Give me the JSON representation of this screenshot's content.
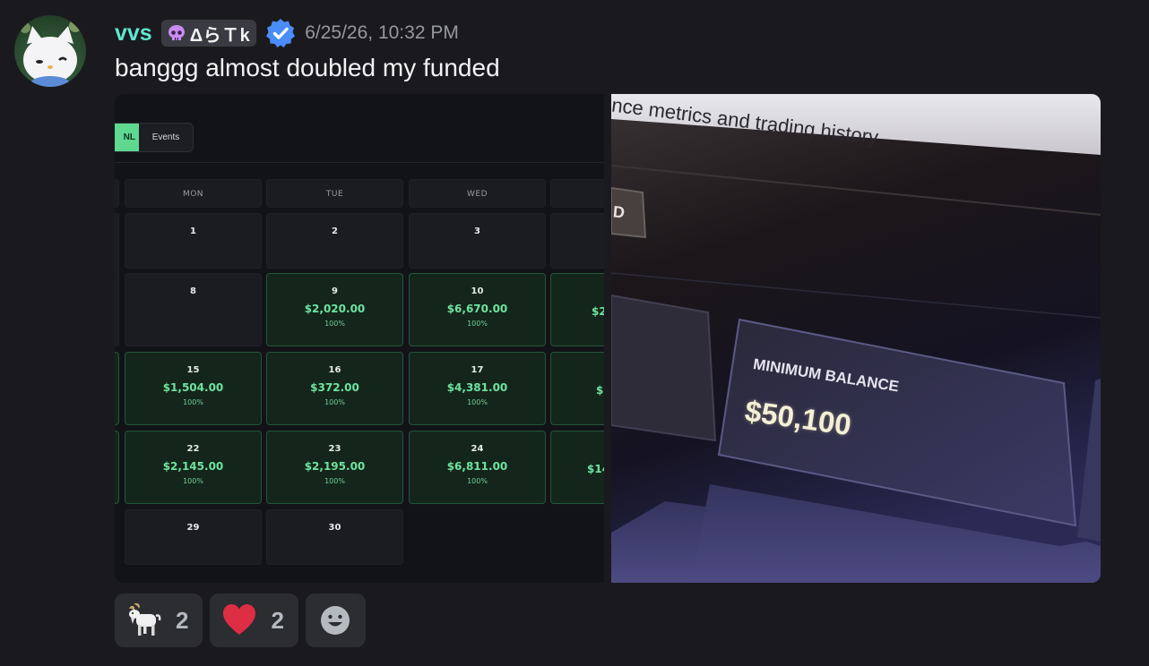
{
  "message": {
    "username": "vvs",
    "server_tag": "ΔらＴk",
    "timestamp": "6/25/26, 10:32 PM",
    "content": "banggg almost doubled my funded",
    "accent_color": "#5ee6d0"
  },
  "calendar": {
    "toggle": {
      "pnl_label": "NL",
      "events_label": "Events"
    },
    "day_headers": [
      "MON",
      "TUE",
      "WED"
    ],
    "weeks": [
      {
        "days": [
          {
            "day": "1",
            "pnl": "",
            "pct": ""
          },
          {
            "day": "2",
            "pnl": "",
            "pct": ""
          },
          {
            "day": "3",
            "pnl": "",
            "pct": ""
          },
          {
            "day": "",
            "pnl": "",
            "pct": ""
          }
        ]
      },
      {
        "days": [
          {
            "day": "8",
            "pnl": "",
            "pct": ""
          },
          {
            "day": "9",
            "pnl": "$2,020.00",
            "pct": "100%"
          },
          {
            "day": "10",
            "pnl": "$6,670.00",
            "pct": "100%"
          },
          {
            "day": "",
            "pnl": "$2",
            "pct": ""
          }
        ]
      },
      {
        "days": [
          {
            "day": "15",
            "pnl": "$1,504.00",
            "pct": "100%"
          },
          {
            "day": "16",
            "pnl": "$372.00",
            "pct": "100%"
          },
          {
            "day": "17",
            "pnl": "$4,381.00",
            "pct": "100%"
          },
          {
            "day": "",
            "pnl": "$",
            "pct": ""
          }
        ]
      },
      {
        "days": [
          {
            "day": "22",
            "pnl": "$2,145.00",
            "pct": "100%"
          },
          {
            "day": "23",
            "pnl": "$2,195.00",
            "pct": "100%"
          },
          {
            "day": "24",
            "pnl": "$6,811.00",
            "pct": "100%"
          },
          {
            "day": "",
            "pnl": "$14",
            "pct": ""
          }
        ]
      },
      {
        "days": [
          {
            "day": "29",
            "pnl": "",
            "pct": ""
          },
          {
            "day": "30",
            "pnl": "",
            "pct": ""
          }
        ]
      }
    ]
  },
  "photo": {
    "header_text": "ance metrics and trading history",
    "button_fragment": "D",
    "card_label": "MINIMUM BALANCE",
    "card_value": "$50,100"
  },
  "reactions": [
    {
      "emoji": "goat",
      "glyph": "🐐",
      "count": "2"
    },
    {
      "emoji": "heart",
      "glyph": "❤",
      "count": "2"
    }
  ],
  "add_reaction_icon": "add-reaction-smiley-icon"
}
